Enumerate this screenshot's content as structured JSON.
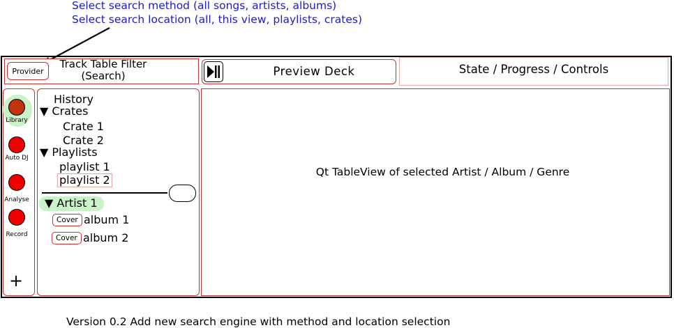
{
  "annotations": {
    "line1": "Select search method (all songs, artists, albums)",
    "line2": "Select search location (all, this view, playlists, crates)"
  },
  "toolbar": {
    "provider_label": "Provider",
    "filter_line1": "Track Table Filter",
    "filter_line2": "(Search)",
    "preview_deck_label": "Preview Deck",
    "state_label": "State / Progress / Controls"
  },
  "sidebar": {
    "items": [
      {
        "label": "Library",
        "icon": "library-icon"
      },
      {
        "label": "Auto DJ",
        "icon": "auto-dj-icon"
      },
      {
        "label": "Analyse",
        "icon": "analyse-icon"
      },
      {
        "label": "Record",
        "icon": "record-icon"
      }
    ],
    "add_label": "+"
  },
  "tree": {
    "history": "History",
    "crates": "▼ Crates",
    "crate_items": [
      "Crate 1",
      "Crate 2"
    ],
    "playlists": "▼ Playlists",
    "playlist_items": [
      "playlist 1",
      "playlist 2"
    ],
    "artist": "▼ Artist 1",
    "albums": [
      {
        "cover": "Cover",
        "name": "album 1"
      },
      {
        "cover": "Cover",
        "name": "album 2"
      }
    ]
  },
  "main": {
    "table_placeholder": "Qt TableView of selected Artist / Album / Genre"
  },
  "footer": {
    "version_note": "Version 0.2 Add new search engine with method and location selection"
  },
  "colors": {
    "annotation": "#1a1ad6",
    "border_red": "#d42a2a",
    "button_red": "#ee0000",
    "selection_green": "#c9f2c9"
  }
}
